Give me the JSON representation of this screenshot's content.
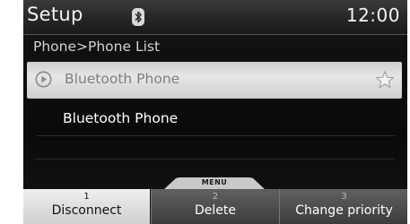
{
  "header": {
    "title": "Setup",
    "status_icon": "bluetooth-icon",
    "clock": "12:00"
  },
  "breadcrumb": "Phone>Phone List",
  "phone_list": [
    {
      "label": "Bluetooth Phone",
      "selected": true,
      "left_icon": "play-circle-icon",
      "right_icon": "star-icon"
    },
    {
      "label": "Bluetooth Phone",
      "selected": false
    }
  ],
  "menu_tab": "MENU",
  "softkeys": [
    {
      "number": "1",
      "label": "Disconnect",
      "active": true
    },
    {
      "number": "2",
      "label": "Delete",
      "active": false
    },
    {
      "number": "3",
      "label": "Change priority",
      "active": false
    }
  ],
  "colors": {
    "selected_row": "#dcdcdc",
    "background": "#111111",
    "active_softkey": "#e0e0e0",
    "inactive_softkey": "#4a4a4a"
  }
}
